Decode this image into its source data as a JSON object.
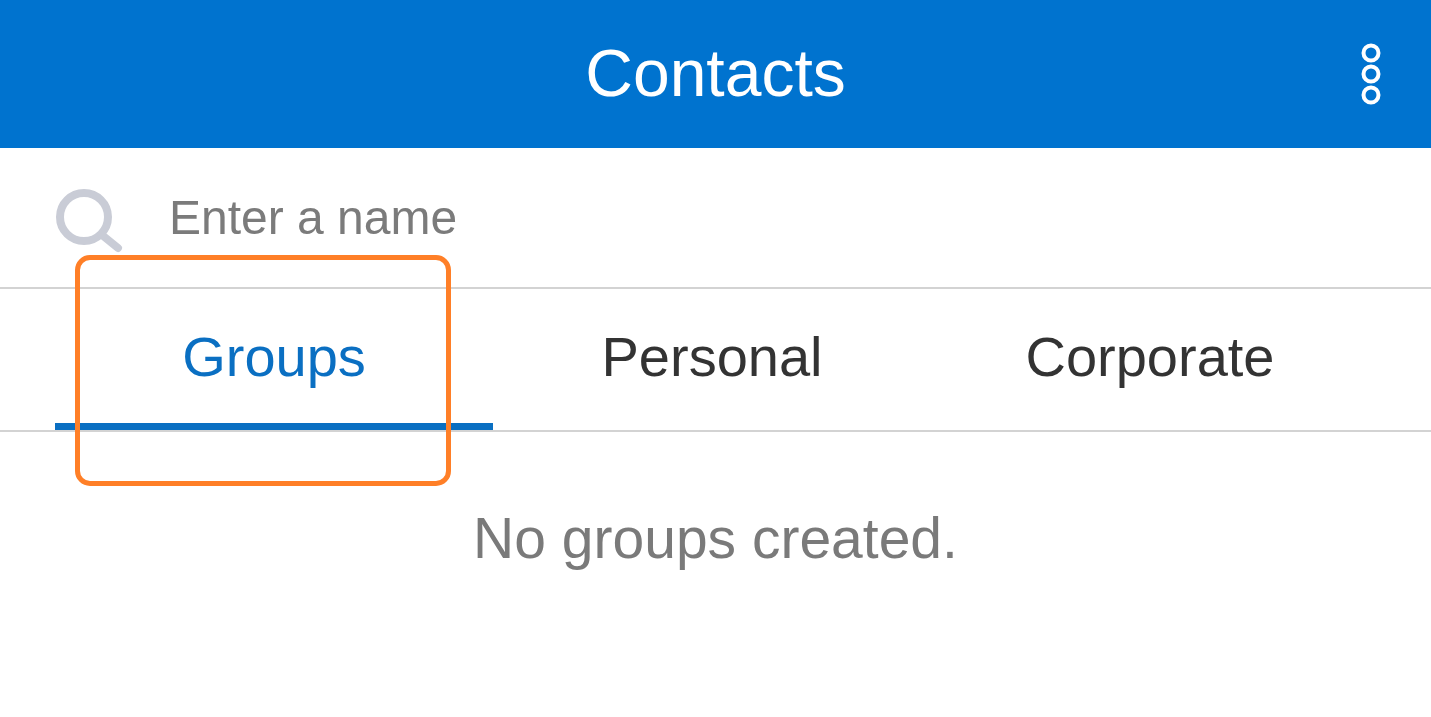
{
  "header": {
    "title": "Contacts"
  },
  "search": {
    "placeholder": "Enter a name"
  },
  "tabs": [
    {
      "label": "Groups",
      "selected": true,
      "highlighted": true
    },
    {
      "label": "Personal",
      "selected": false,
      "highlighted": false
    },
    {
      "label": "Corporate",
      "selected": false,
      "highlighted": false
    }
  ],
  "empty_message": "No groups created."
}
